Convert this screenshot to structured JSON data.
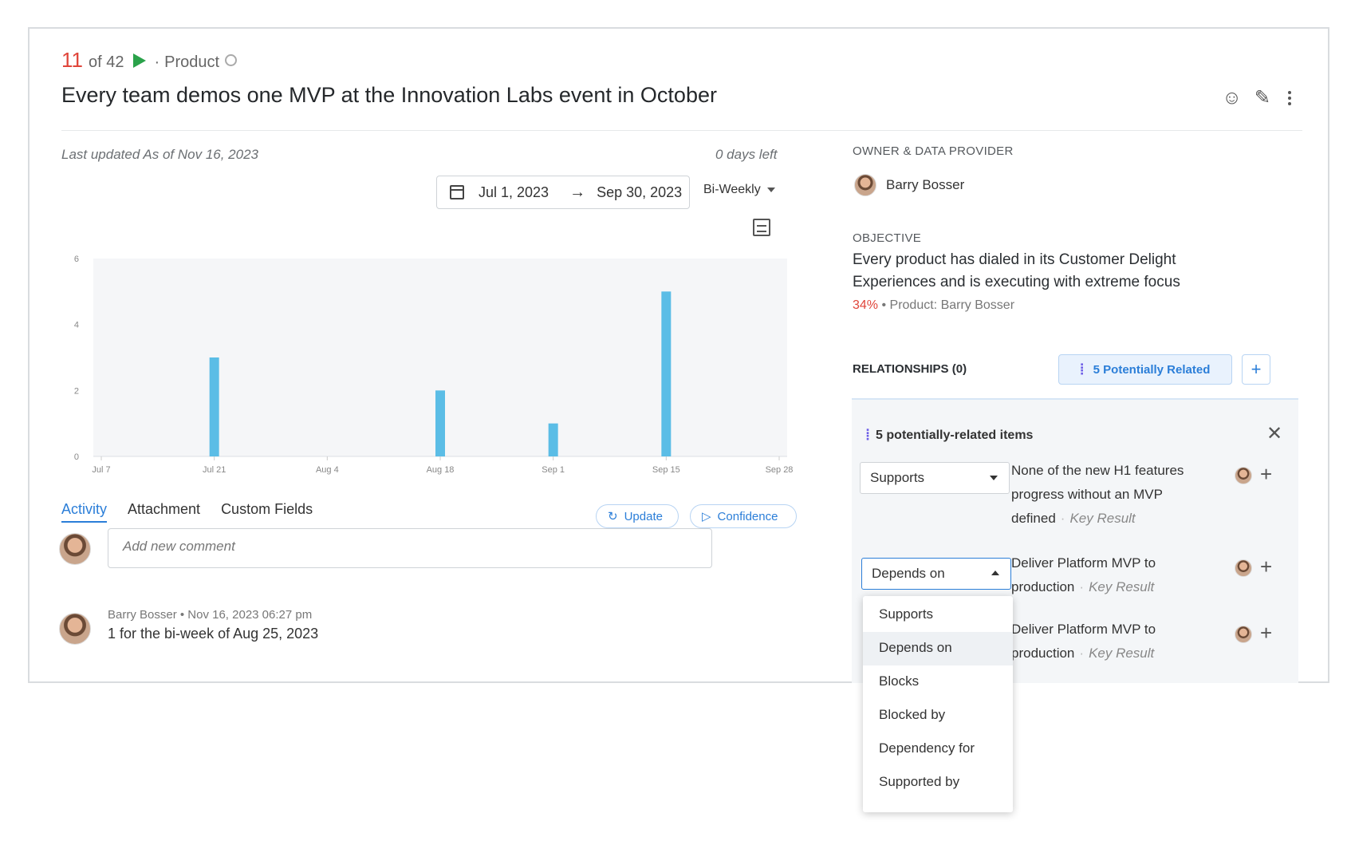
{
  "header": {
    "position": "11",
    "of_total": "of 42",
    "category": "Product",
    "title": "Every team demos one MVP at the Innovation Labs event in October"
  },
  "icons": [
    "emoji-add-icon",
    "pencil-icon",
    "kebab-icon",
    "globe-icon",
    "calendar-icon",
    "table-icon",
    "refresh-icon",
    "play-icon",
    "close-icon",
    "plus-icon"
  ],
  "status": {
    "last_updated": "Last updated As of Nov 16, 2023",
    "days_left": "0 days left"
  },
  "date_range": {
    "start": "Jul 1, 2023",
    "end": "Sep 30, 2023",
    "period": "Bi-Weekly"
  },
  "chart_data": {
    "type": "bar",
    "x_ticks": [
      "Jul 7",
      "Jul 21",
      "Aug 4",
      "Aug 18",
      "Sep 1",
      "Sep 15",
      "Sep 28"
    ],
    "categories": [
      "Jul 21",
      "Aug 18",
      "Sep 1",
      "Sep 15"
    ],
    "values": [
      3,
      2,
      1,
      5
    ],
    "y_ticks": [
      "0",
      "2",
      "4",
      "6"
    ],
    "ylim": [
      0,
      6
    ],
    "bar_color": "#5bbde6",
    "grid": false,
    "title": "",
    "xlabel": "",
    "ylabel": ""
  },
  "tabs": [
    "Activity",
    "Attachment",
    "Custom Fields"
  ],
  "actions": {
    "update": "Update",
    "confidence": "Confidence"
  },
  "comment": {
    "placeholder": "Add new comment"
  },
  "activity": {
    "meta": "Barry Bosser • Nov 16, 2023 06:27 pm",
    "text": "1 for the bi-week of Aug 25, 2023"
  },
  "owner": {
    "label": "OWNER & DATA PROVIDER",
    "name": "Barry Bosser"
  },
  "objective": {
    "label": "OBJECTIVE",
    "text": "Every product has dialed in its Customer Delight Experiences and is executing with extreme focus",
    "percent": "34%",
    "meta": "• Product: Barry Bosser"
  },
  "relationships": {
    "label": "RELATIONSHIPS (0)",
    "related_button": "5 Potentially Related",
    "panel_title": "5 potentially-related items",
    "key_result": "Key Result",
    "items": [
      {
        "relation": "Supports",
        "text": "None of the new H1 features progress without an MVP defined"
      },
      {
        "relation": "Depends on",
        "text": "Deliver Platform MVP to production"
      },
      {
        "relation": "",
        "text": "Deliver Platform MVP to production"
      }
    ],
    "dropdown_options": [
      "Supports",
      "Depends on",
      "Blocks",
      "Blocked by",
      "Dependency for",
      "Supported by"
    ],
    "selected_option": "Depends on"
  },
  "colors": {
    "accent_blue": "#2b7ed8",
    "alert_red": "#e0453a",
    "play_green": "#2aa24a"
  }
}
